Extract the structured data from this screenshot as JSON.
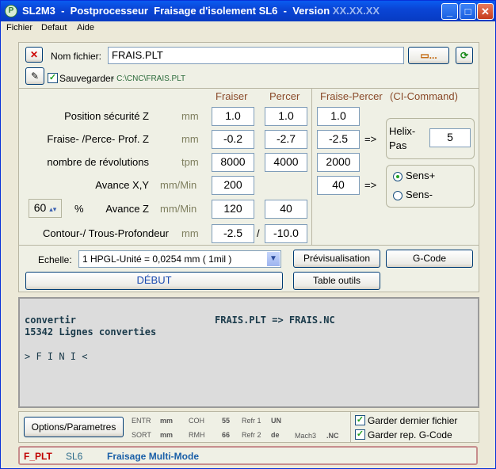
{
  "window": {
    "title_prefix": "SL2M3  -  Postprocesseur  Fraisage d'isolement SL6  -  Version ",
    "title_version": "XX.XX.XX",
    "app_icon": "P"
  },
  "menu": {
    "items": [
      "Fichier",
      "Defaut",
      "Aide"
    ]
  },
  "file": {
    "label": "Nom fichier:",
    "value": "FRAIS.PLT",
    "browse_label": "...",
    "save_label": "Sauvegarder",
    "save_path": "- C:\\CNC\\FRAIS.PLT",
    "save_checked": true
  },
  "table": {
    "headers": {
      "fraiser": "Fraiser",
      "percer": "Percer",
      "fraise_percer": "Fraise-Percer",
      "ci": "(CI-Command)"
    },
    "rows": [
      {
        "label": "Position sécurité Z",
        "unit": "mm",
        "fraiser": "1.0",
        "percer": "1.0",
        "fp": "1.0"
      },
      {
        "label": "Fraise- /Perce-  Prof. Z",
        "unit": "mm",
        "fraiser": "-0.2",
        "percer": "-2.7",
        "fp": "-2.5"
      },
      {
        "label": "nombre de révolutions",
        "unit": "tpm",
        "fraiser": "8000",
        "percer": "4000",
        "fp": "2000"
      },
      {
        "label": "Avance X,Y",
        "unit": "mm/Min",
        "fraiser": "200",
        "fp": "40"
      },
      {
        "label": "Avance Z",
        "unit": "mm/Min",
        "fraiser": "120",
        "percer": "40"
      },
      {
        "label": "Contour-/ Trous-Profondeur",
        "unit": "mm",
        "fraiser": "-2.5",
        "percer": "-10.0"
      }
    ],
    "arrow": "=>",
    "slash": "/",
    "percent_value": "60",
    "percent_sign": "%"
  },
  "helix": {
    "label1": "Helix-",
    "label2": "Pas",
    "value": "5"
  },
  "sens": {
    "plus": "Sens+",
    "minus": "Sens-",
    "selected": "Sens+"
  },
  "scale": {
    "label": "Echelle:",
    "value": "1 HPGL-Unité = 0,0254 mm ( 1mil )"
  },
  "buttons": {
    "preview": "Prévisualisation",
    "gcode": "G-Code",
    "start": "DÉBUT",
    "tools": "Table outils",
    "options": "Options/Parametres"
  },
  "console": {
    "line1_left": "convertir",
    "line1_right": "FRAIS.PLT   =>   FRAIS.NC",
    "line2": "15342  Lignes converties",
    "line3": "> F I N I <"
  },
  "status": {
    "entr": "ENTR",
    "entr_v": "mm",
    "sort": "SORT",
    "sort_v": "mm",
    "coh": "COH",
    "coh_v": "55",
    "rmh": "RMH",
    "rmh_v": "66",
    "refr1": "Refr 1",
    "refr1_v": "UN",
    "refr2": "Refr 2",
    "refr2_v": "de",
    "mach": "Mach3",
    "ext": ".NC"
  },
  "options": {
    "keep_file": "Garder dernier fichier",
    "keep_dir": "Garder rep. G-Code"
  },
  "footer": {
    "a": "F_PLT",
    "b": "SL6",
    "c": "Fraisage Multi-Mode"
  },
  "colors": {
    "title_bar": "#0a45d6",
    "panel": "#eff0e5",
    "header_text": "#8a4a2a",
    "footer_a": "#c00000",
    "footer_b": "#2a6a8a",
    "footer_c": "#1a5fa8"
  }
}
